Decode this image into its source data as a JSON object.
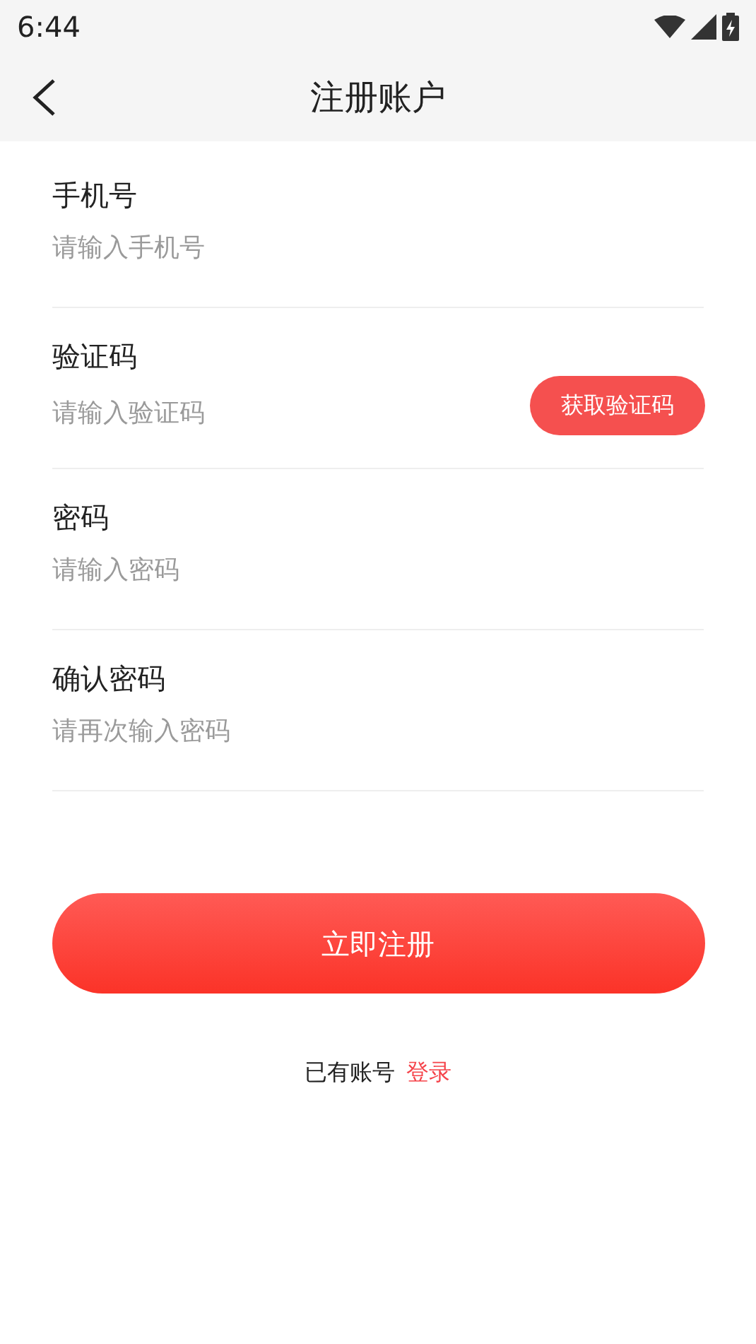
{
  "status_bar": {
    "time": "6:44"
  },
  "header": {
    "title": "注册账户"
  },
  "fields": [
    {
      "kind": "text",
      "label": "手机号",
      "placeholder": "请输入手机号"
    },
    {
      "kind": "code",
      "label": "验证码",
      "placeholder": "请输入验证码",
      "action": "获取验证码"
    },
    {
      "kind": "password",
      "label": "密码",
      "placeholder": "请输入密码"
    },
    {
      "kind": "password",
      "label": "确认密码",
      "placeholder": "请再次输入密码"
    }
  ],
  "submit": "立即注册",
  "footer": {
    "text": "已有账号",
    "link": "登录"
  }
}
